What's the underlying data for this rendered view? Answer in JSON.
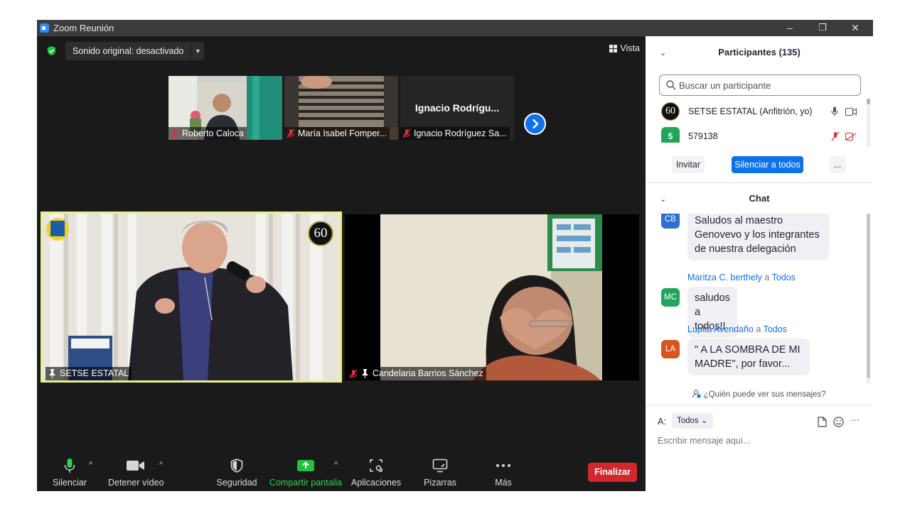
{
  "window": {
    "title": "Zoom Reunión",
    "controls": [
      "–",
      "❐",
      "✕"
    ]
  },
  "meeting": {
    "sound_label": "Sonido original: desactivado",
    "view_label": "Vista",
    "thumbnails": [
      {
        "name": "Roberto Caloca",
        "muted": true
      },
      {
        "name": "María Isabel Fomper...",
        "muted": true
      },
      {
        "name": "Ignacio Rodríguez Sa...",
        "display_name": "Ignacio  Rodrígu...",
        "muted": true
      }
    ],
    "tiles": [
      {
        "name": "SETSE ESTATAL",
        "badge": "60",
        "active_speaker": true,
        "pinned": true,
        "muted": false
      },
      {
        "name": "Candelaria Barrios Sánchez",
        "pinned": true,
        "muted": true
      }
    ]
  },
  "toolbar": {
    "mute": "Silenciar",
    "video": "Detener vídeo",
    "security": "Seguridad",
    "share": "Compartir pantalla",
    "apps": "Aplicaciones",
    "whiteboards": "Pizarras",
    "more": "Más",
    "end": "Finalizar"
  },
  "colors": {
    "accent": "#0e72ed",
    "share_green": "#21c23d",
    "end_red": "#d3262d",
    "speaker_border": "#e8f08a"
  },
  "participants_panel": {
    "title": "Participantes (135)",
    "search_placeholder": "Buscar un participante",
    "list": [
      {
        "avatar": "60",
        "name": "SETSE ESTATAL (Anfitrión, yo)"
      },
      {
        "avatar": "5",
        "name": "579138"
      }
    ],
    "invite": "Invitar",
    "mute_all": "Silenciar a todos",
    "more": "..."
  },
  "chat_panel": {
    "title": "Chat",
    "messages": [
      {
        "initials": "CB",
        "avatar_color": "#2d6fd0",
        "sender": "",
        "to_word": "",
        "target": "",
        "lines": [
          "Saludos al maestro",
          "Genovevo y los integrantes",
          "de nuestra delegación"
        ]
      },
      {
        "initials": "MC",
        "avatar_color": "#22a55b",
        "sender": "Maritza C. berthely",
        "to_word": "a",
        "target": "Todos",
        "lines": [
          "saludos a todos!!"
        ]
      },
      {
        "initials": "LA",
        "avatar_color": "#d9541e",
        "sender": "Lupita Avendaño",
        "to_word": "a",
        "target": "Todos",
        "lines": [
          "\" A LA SOMBRA DE MI",
          "MADRE\", por favor..."
        ]
      }
    ],
    "who_can_see": "¿Quién puede ver sus mensajes?",
    "to_label": "A:",
    "recipient": "Todos",
    "input_placeholder": "Escribir mensaje aquí..."
  }
}
